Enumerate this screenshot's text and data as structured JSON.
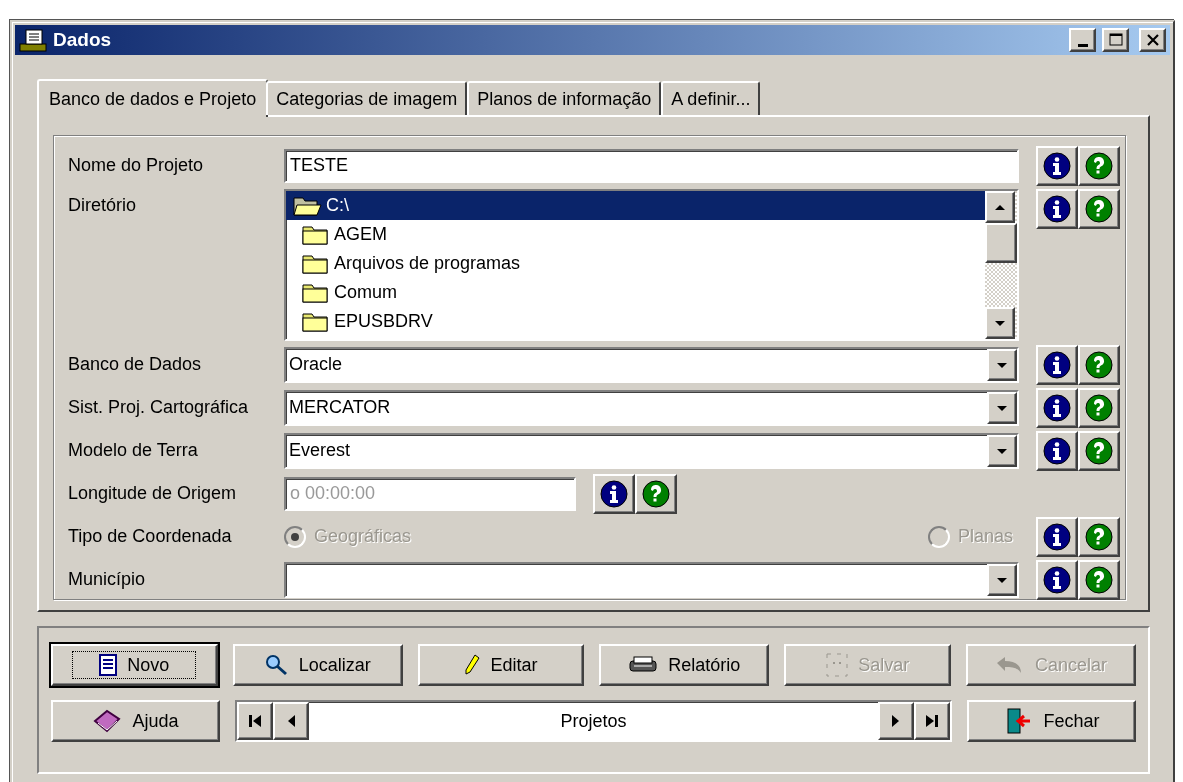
{
  "window": {
    "title": "Dados"
  },
  "tabs": [
    {
      "label": "Banco de dados e Projeto",
      "selected": true
    },
    {
      "label": "Categorias de imagem",
      "selected": false
    },
    {
      "label": "Planos de informação",
      "selected": false
    },
    {
      "label": "A definir...",
      "selected": false
    }
  ],
  "form": {
    "rows": [
      {
        "kind": "text",
        "label": "Nome do Projeto",
        "value": "TESTE"
      },
      {
        "kind": "tree",
        "label": "Diretório",
        "items": [
          {
            "label": "C:\\",
            "selected": true,
            "expanded": true,
            "children": [
              {
                "label": "AGEM",
                "selected": false
              },
              {
                "label": "Arquivos de programas",
                "selected": false
              },
              {
                "label": "Comum",
                "selected": false
              },
              {
                "label": "EPUSBDRV",
                "selected": false
              }
            ]
          }
        ]
      },
      {
        "kind": "combo",
        "label": "Banco de Dados",
        "value": "Oracle"
      },
      {
        "kind": "combo",
        "label": "Sist. Proj. Cartográfica",
        "value": "MERCATOR"
      },
      {
        "kind": "combo",
        "label": "Modelo de Terra",
        "value": "Everest"
      },
      {
        "kind": "short",
        "label": "Longitude de Origem",
        "placeholder": "o 00:00:00",
        "disabled": true
      },
      {
        "kind": "radio",
        "label": "Tipo de Coordenada",
        "disabled": true,
        "options": [
          {
            "label": "Geográficas",
            "selected": true
          },
          {
            "label": "Planas",
            "selected": false
          }
        ]
      },
      {
        "kind": "combo",
        "label": "Município"
      }
    ]
  },
  "buttons": [
    {
      "label": "Novo",
      "disabled": false,
      "focused": true
    },
    {
      "label": "Localizar",
      "disabled": false,
      "focused": false
    },
    {
      "label": "Editar",
      "disabled": false,
      "focused": false
    },
    {
      "label": "Relatório",
      "disabled": false,
      "focused": false
    },
    {
      "label": "Salvar",
      "disabled": true,
      "focused": false
    },
    {
      "label": "Cancelar",
      "disabled": true,
      "focused": false
    }
  ],
  "help_button": {
    "label": "Ajuda"
  },
  "navigator": {
    "label": "Projetos"
  },
  "close_button": {
    "label": "Fechar"
  }
}
